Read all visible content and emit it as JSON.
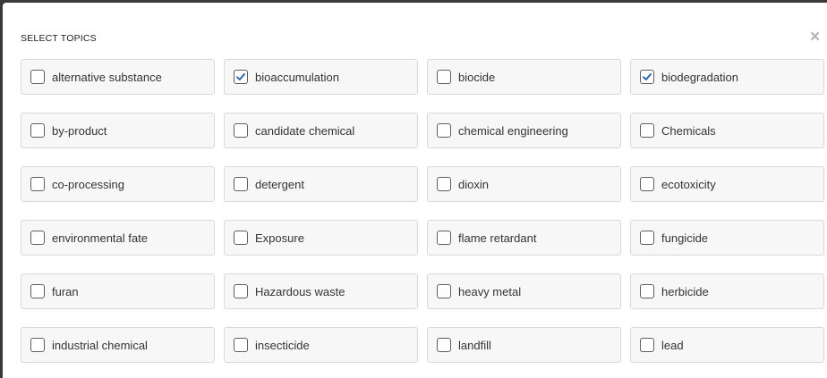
{
  "dialog": {
    "title": "SELECT TOPICS",
    "close_label": "×"
  },
  "colors": {
    "check_mark": "#1a5fb4",
    "tile_background": "#f7f7f7",
    "tile_border": "#d9d9d9"
  },
  "topics": [
    {
      "label": "alternative substance",
      "checked": false
    },
    {
      "label": "bioaccumulation",
      "checked": true
    },
    {
      "label": "biocide",
      "checked": false
    },
    {
      "label": "biodegradation",
      "checked": true
    },
    {
      "label": "by-product",
      "checked": false
    },
    {
      "label": "candidate chemical",
      "checked": false
    },
    {
      "label": "chemical engineering",
      "checked": false
    },
    {
      "label": "Chemicals",
      "checked": false
    },
    {
      "label": "co-processing",
      "checked": false
    },
    {
      "label": "detergent",
      "checked": false
    },
    {
      "label": "dioxin",
      "checked": false
    },
    {
      "label": "ecotoxicity",
      "checked": false
    },
    {
      "label": "environmental fate",
      "checked": false
    },
    {
      "label": "Exposure",
      "checked": false
    },
    {
      "label": "flame retardant",
      "checked": false
    },
    {
      "label": "fungicide",
      "checked": false
    },
    {
      "label": "furan",
      "checked": false
    },
    {
      "label": "Hazardous waste",
      "checked": false
    },
    {
      "label": "heavy metal",
      "checked": false
    },
    {
      "label": "herbicide",
      "checked": false
    },
    {
      "label": "industrial chemical",
      "checked": false
    },
    {
      "label": "insecticide",
      "checked": false
    },
    {
      "label": "landfill",
      "checked": false
    },
    {
      "label": "lead",
      "checked": false
    }
  ]
}
